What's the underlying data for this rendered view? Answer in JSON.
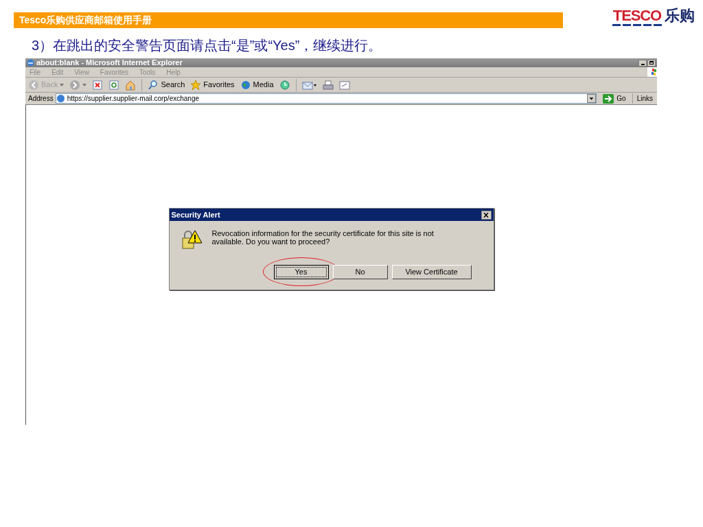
{
  "header": {
    "title": "Tesco乐购供应商邮箱使用手册"
  },
  "logo": {
    "brand": "TESCO",
    "chinese": "乐购"
  },
  "instruction": "3）在跳出的安全警告页面请点击“是”或“Yes”，继续进行。",
  "browser": {
    "title": "about:blank - Microsoft Internet Explorer",
    "menu": [
      "File",
      "Edit",
      "View",
      "Favorites",
      "Tools",
      "Help"
    ],
    "toolbar": [
      {
        "kind": "nav",
        "label": "Back",
        "disabled": true
      },
      {
        "kind": "nav",
        "disabled": false
      },
      {
        "kind": "icon"
      },
      {
        "kind": "icon"
      },
      {
        "kind": "icon"
      },
      {
        "kind": "sep"
      },
      {
        "kind": "labeled",
        "label": "Search"
      },
      {
        "kind": "labeled",
        "label": "Favorites"
      },
      {
        "kind": "labeled",
        "label": "Media"
      },
      {
        "kind": "icon"
      },
      {
        "kind": "sep"
      },
      {
        "kind": "icon"
      },
      {
        "kind": "icon"
      },
      {
        "kind": "icon"
      }
    ],
    "address": {
      "label": "Address",
      "value": "https://supplier.supplier-mail.corp/exchange",
      "go": "Go",
      "links": "Links"
    }
  },
  "dialog": {
    "title": "Security Alert",
    "message": "Revocation information for the security certificate for this site is not available. Do you want to proceed?",
    "buttons": [
      {
        "label": "Yes",
        "highlighted": true
      },
      {
        "label": "No",
        "highlighted": false
      },
      {
        "label": "View Certificate",
        "highlighted": false
      }
    ]
  }
}
